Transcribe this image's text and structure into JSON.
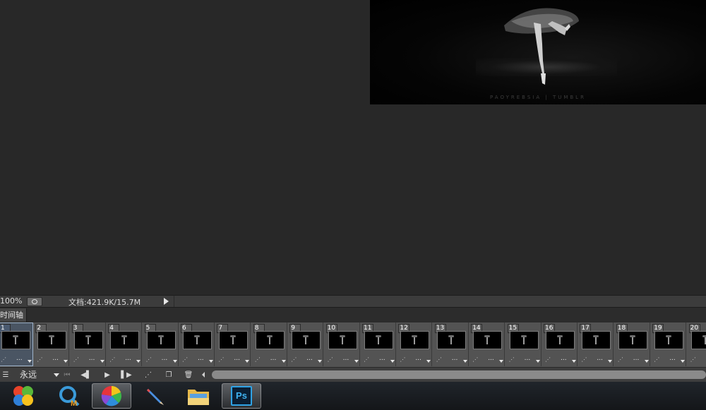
{
  "status_bar": {
    "zoom": "100%",
    "doc_size": "文档:421.9K/15.7M"
  },
  "document": {
    "watermark": "PAOYREBSIA | TUMBLR"
  },
  "timeline": {
    "tab_label": "时间轴",
    "frames": [
      {
        "number": "1",
        "delay": "..."
      },
      {
        "number": "2",
        "delay": "..."
      },
      {
        "number": "3",
        "delay": "..."
      },
      {
        "number": "4",
        "delay": "..."
      },
      {
        "number": "5",
        "delay": "..."
      },
      {
        "number": "6",
        "delay": "..."
      },
      {
        "number": "7",
        "delay": "..."
      },
      {
        "number": "8",
        "delay": "..."
      },
      {
        "number": "9",
        "delay": "..."
      },
      {
        "number": "10",
        "delay": "..."
      },
      {
        "number": "11",
        "delay": "..."
      },
      {
        "number": "12",
        "delay": "..."
      },
      {
        "number": "13",
        "delay": "..."
      },
      {
        "number": "14",
        "delay": "..."
      },
      {
        "number": "15",
        "delay": "..."
      },
      {
        "number": "16",
        "delay": "..."
      },
      {
        "number": "17",
        "delay": "..."
      },
      {
        "number": "18",
        "delay": "..."
      },
      {
        "number": "19",
        "delay": "..."
      },
      {
        "number": "20",
        "delay": "..."
      }
    ],
    "selected_frame": "1",
    "loop_option": "永远"
  },
  "taskbar": {
    "apps": [
      {
        "name": "windows-start-icon"
      },
      {
        "name": "maxthon-browser-icon"
      },
      {
        "name": "color-wheel-app-icon"
      },
      {
        "name": "pencil-editor-icon"
      },
      {
        "name": "folder-explorer-icon"
      },
      {
        "name": "photoshop-icon",
        "label": "Ps"
      }
    ]
  }
}
